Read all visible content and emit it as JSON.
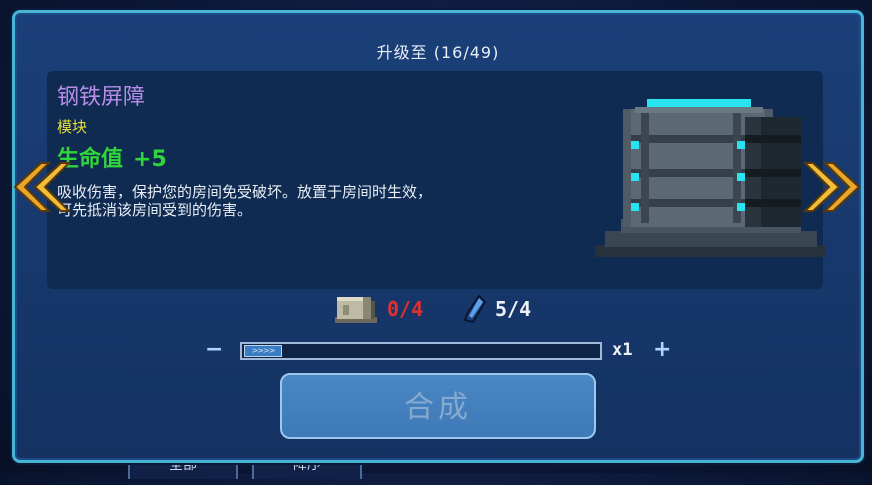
{
  "dialog": {
    "title": "升级至 (16/49)",
    "item_name": "钢铁屏障",
    "item_type": "模块",
    "stat_name": "生命值",
    "stat_value": "+5",
    "description_line1": "吸收伤害，保护您的房间免受破坏。放置于房间时生效，",
    "description_line2": "可先抵消该房间受到的伤害。",
    "item_icon": "steel-barrier-module-icon"
  },
  "requirements": {
    "plates": {
      "icon": "metal-plate-icon",
      "text": "0/4",
      "color": "#e03030"
    },
    "crystal": {
      "icon": "crystal-shard-icon",
      "text": "5/4",
      "color": "#eef2f8"
    }
  },
  "quantity": {
    "minus_label": "−",
    "plus_label": "+",
    "value_label": "x1",
    "knob_label": ">>>>",
    "fill_fraction": 0.1
  },
  "craft_button": {
    "label": "合成",
    "enabled": false
  },
  "background_tabs": [
    "全部",
    "降序"
  ],
  "colors": {
    "border_accent": "#47b6d6",
    "item_name": "#b78de8",
    "item_type": "#e6dc3a",
    "stat": "#2fd53a",
    "arrow": "#e8a72a"
  }
}
